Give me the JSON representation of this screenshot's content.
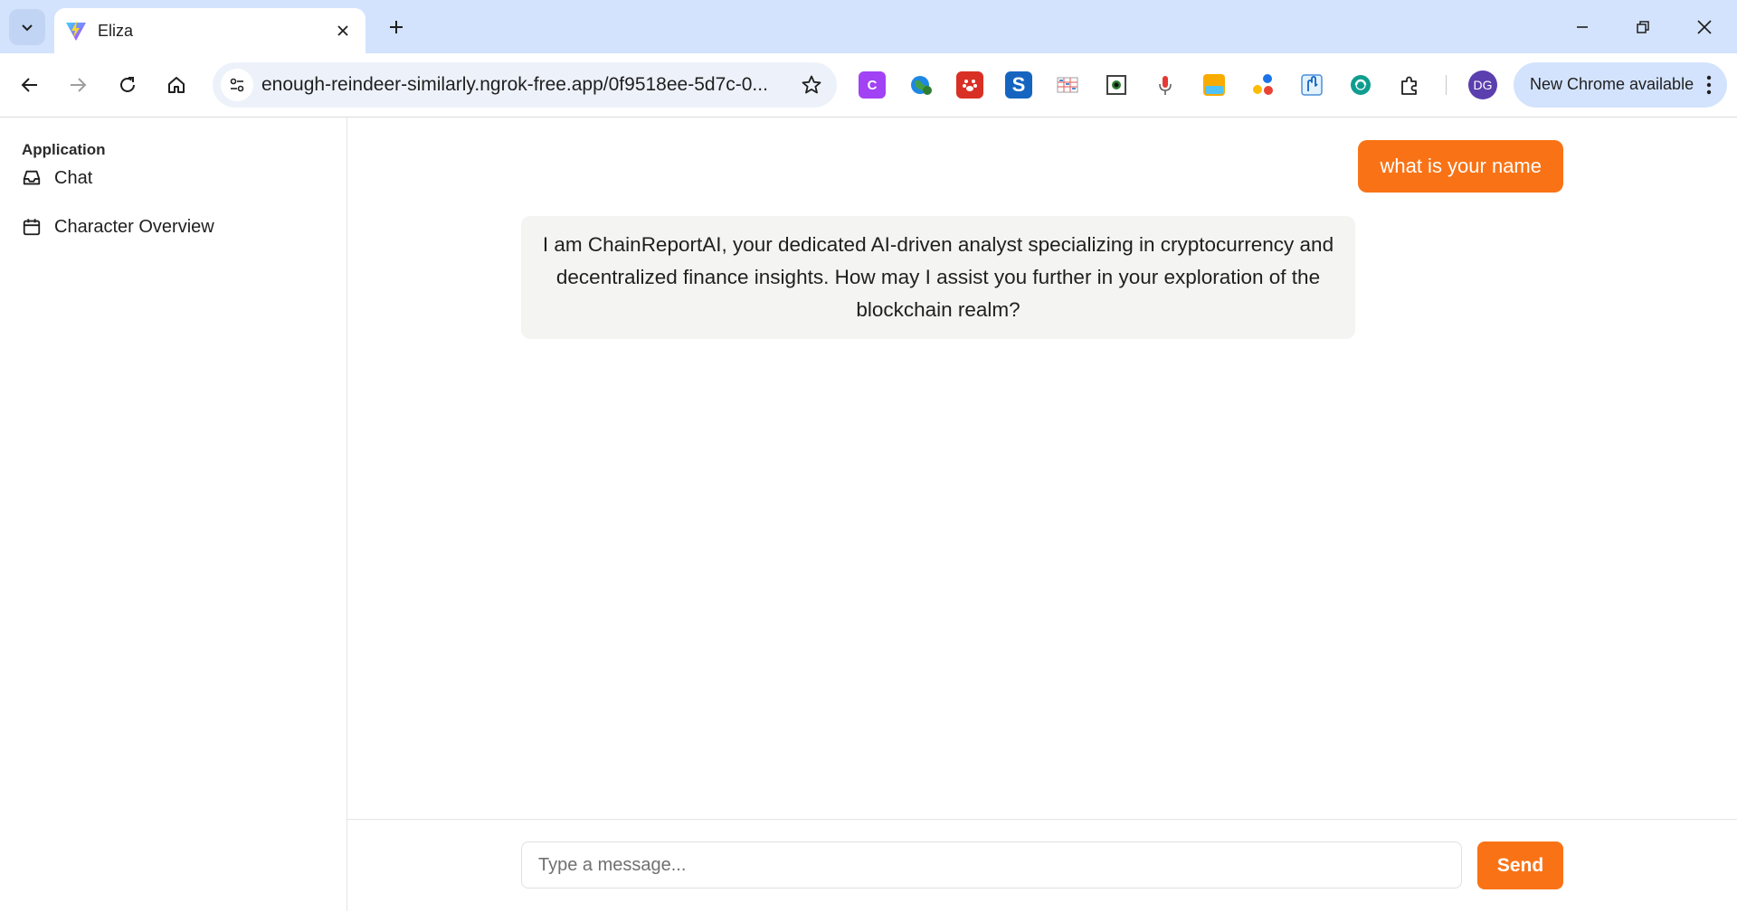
{
  "browser": {
    "tab": {
      "title": "Eliza"
    },
    "address_bar": {
      "url": "enough-reindeer-similarly.ngrok-free.app/0f9518ee-5d7c-0..."
    },
    "profile": {
      "initials": "DG"
    },
    "update": {
      "label": "New Chrome available"
    },
    "extensions": [
      {
        "icon": "purple-c-extension-icon",
        "color": "#a142f4",
        "glyph": "C"
      },
      {
        "icon": "globe-extension-icon",
        "color": "#2e7d32",
        "glyph": ""
      },
      {
        "icon": "red-paw-extension-icon",
        "color": "#d93025",
        "glyph": ""
      },
      {
        "icon": "s-extension-icon",
        "color": "#1565c0",
        "glyph": "S"
      },
      {
        "icon": "grid-extension-icon",
        "color": "#8e8e8e",
        "glyph": ""
      },
      {
        "icon": "screenshot-extension-icon",
        "color": "#424242",
        "glyph": ""
      },
      {
        "icon": "microphone-extension-icon",
        "color": "#e53935",
        "glyph": ""
      },
      {
        "icon": "webp-png-extension-icon",
        "color": "#f9ab00",
        "glyph": ""
      },
      {
        "icon": "dots-extension-icon",
        "color": "#fbbc04",
        "glyph": ""
      },
      {
        "icon": "hand-extension-icon",
        "color": "#4a90d9",
        "glyph": ""
      },
      {
        "icon": "teal-circle-extension-icon",
        "color": "#0f9d8f",
        "glyph": ""
      }
    ]
  },
  "sidebar": {
    "header": "Application",
    "items": [
      {
        "label": "Chat",
        "icon": "inbox-icon"
      },
      {
        "label": "Character Overview",
        "icon": "calendar-icon"
      }
    ]
  },
  "chat": {
    "messages": [
      {
        "role": "user",
        "text": "what is your name"
      },
      {
        "role": "assistant",
        "text": "I am ChainReportAI, your dedicated AI-driven analyst specializing in cryptocurrency and decentralized finance insights. How may I assist you further in your exploration of the blockchain realm?"
      }
    ],
    "input": {
      "placeholder": "Type a message...",
      "value": ""
    },
    "send_label": "Send"
  },
  "colors": {
    "accent": "#f97316",
    "bot_bubble": "#f4f4f2",
    "tabstrip": "#d3e3fd"
  }
}
